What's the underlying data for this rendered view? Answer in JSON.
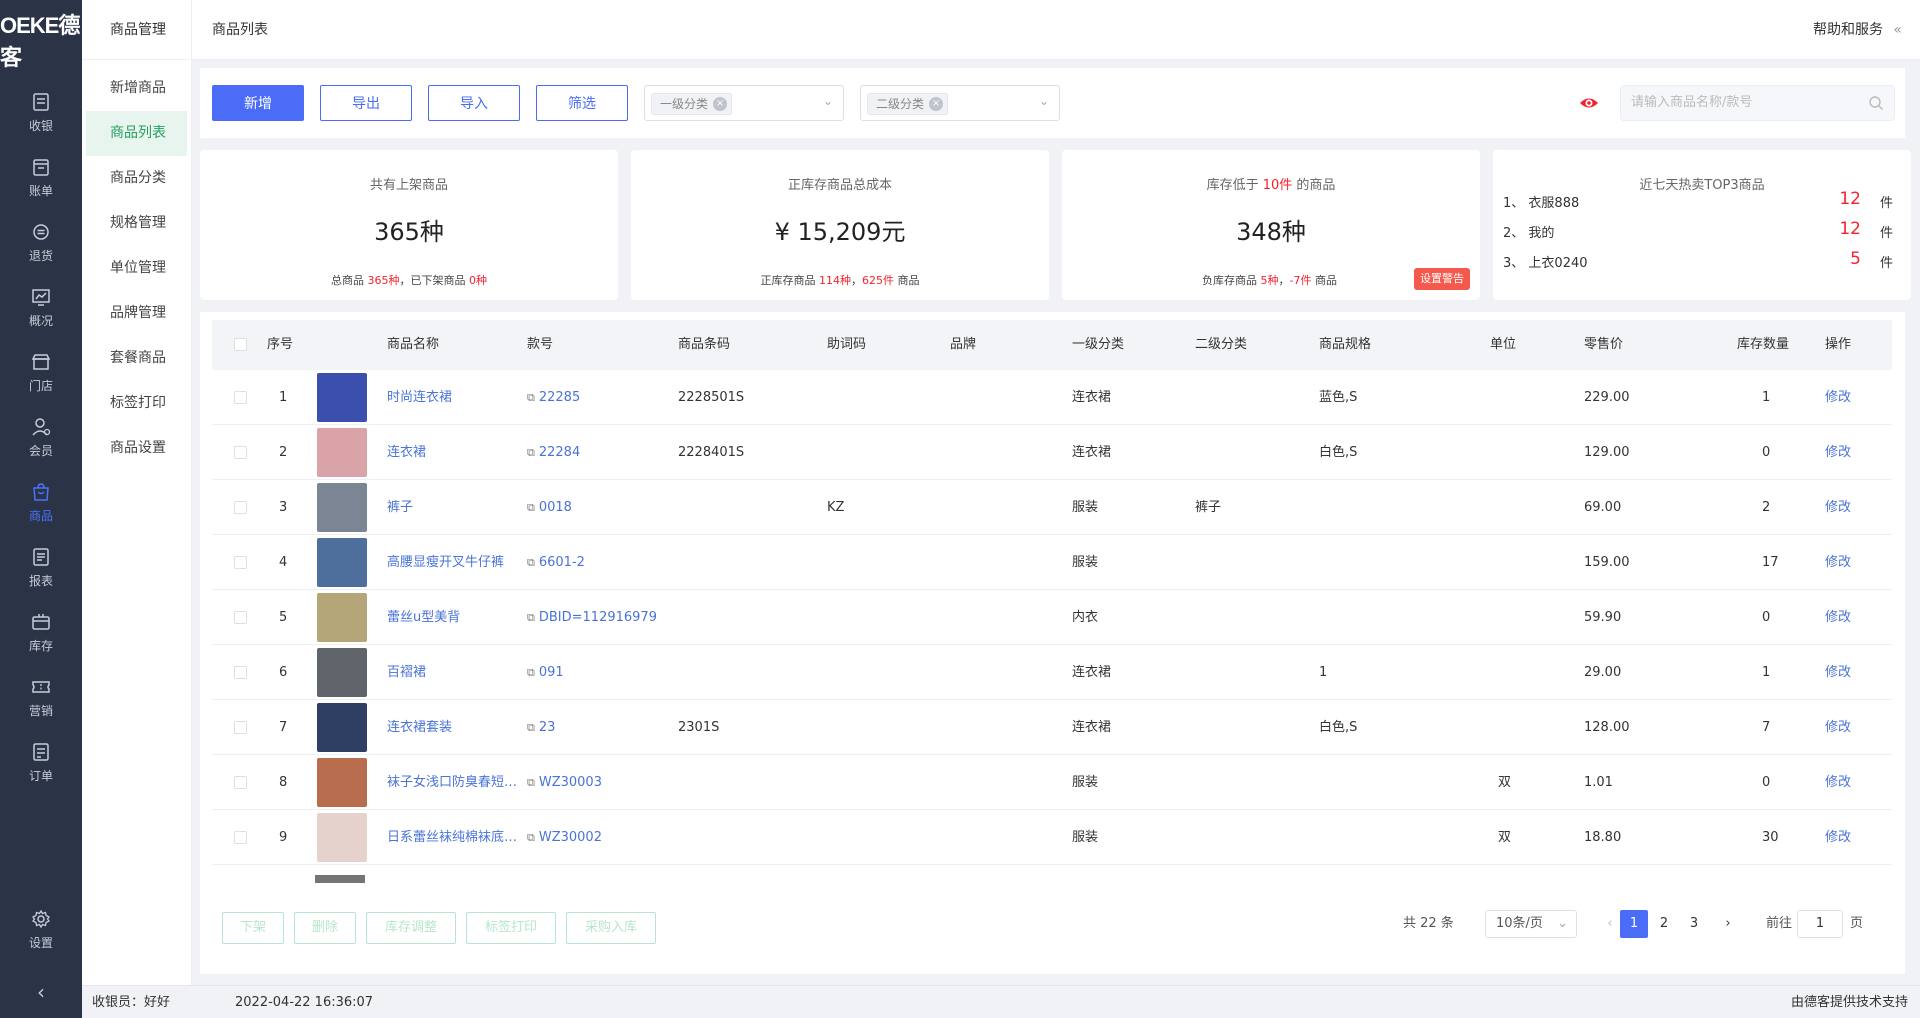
{
  "brand": {
    "logo_text": "OEKE德客"
  },
  "leftnav": [
    {
      "label": "收银",
      "icon": "cashier-icon"
    },
    {
      "label": "账单",
      "icon": "bill-icon"
    },
    {
      "label": "退货",
      "icon": "return-icon"
    },
    {
      "label": "概况",
      "icon": "overview-chart-icon"
    },
    {
      "label": "门店",
      "icon": "store-icon"
    },
    {
      "label": "会员",
      "icon": "member-icon"
    },
    {
      "label": "商品",
      "icon": "goods-bag-icon",
      "active": true
    },
    {
      "label": "报表",
      "icon": "report-icon"
    },
    {
      "label": "库存",
      "icon": "inventory-box-icon"
    },
    {
      "label": "营销",
      "icon": "marketing-ticket-icon"
    },
    {
      "label": "订单",
      "icon": "order-icon"
    }
  ],
  "settings": {
    "label": "设置",
    "icon": "gear-icon"
  },
  "submenu": {
    "title": "商品管理",
    "items": [
      "新增商品",
      "商品列表",
      "商品分类",
      "规格管理",
      "单位管理",
      "品牌管理",
      "套餐商品",
      "标签打印",
      "商品设置"
    ],
    "active_index": 1
  },
  "topbar": {
    "breadcrumb": "商品列表",
    "help": "帮助和服务"
  },
  "toolbar": {
    "add": "新增",
    "export": "导出",
    "import": "导入",
    "filter": "筛选",
    "cat1_tag": "一级分类",
    "cat2_tag": "二级分类",
    "search_placeholder": "请输入商品名称/款号"
  },
  "cards": {
    "c1": {
      "title": "共有上架商品",
      "value": "365种",
      "foot_a": "总商品 ",
      "foot_b": "365种",
      "foot_c": "，已下架商品 ",
      "foot_d": "0种"
    },
    "c2": {
      "title": "正库存商品总成本",
      "value": "¥ 15,209元",
      "foot_a": "正库存商品 ",
      "foot_b": "114种",
      "foot_c": "，",
      "foot_d": "625件",
      "foot_e": " 商品"
    },
    "c3": {
      "title_a": "库存低于 ",
      "title_b": "10件",
      "title_c": " 的商品",
      "value": "348种",
      "foot_a": "负库存商品 ",
      "foot_b": "5种",
      "foot_c": "，",
      "foot_d": "-7件",
      "foot_e": " 商品",
      "warn": "设置警告"
    },
    "c4": {
      "title": "近七天热卖TOP3商品",
      "items": [
        {
          "rank": "1、",
          "name": "衣服888",
          "count": "12",
          "unit": "件"
        },
        {
          "rank": "2、",
          "name": "我的",
          "count": "12",
          "unit": "件"
        },
        {
          "rank": "3、",
          "name": "上衣0240",
          "count": "5",
          "unit": "件"
        }
      ]
    }
  },
  "table": {
    "headers": [
      "序号",
      "商品名称",
      "款号",
      "商品条码",
      "助词码",
      "品牌",
      "一级分类",
      "二级分类",
      "商品规格",
      "单位",
      "零售价",
      "库存数量",
      "操作"
    ],
    "rows": [
      {
        "no": "1",
        "name": "时尚连衣裙",
        "style": "22285",
        "barcode": "2228501S",
        "code": "",
        "brand": "",
        "cat1": "连衣裙",
        "cat2": "",
        "spec": "蓝色,S",
        "unit": "",
        "price": "229.00",
        "stock": "1",
        "op": "修改",
        "thumb": "#3a4fae"
      },
      {
        "no": "2",
        "name": "连衣裙",
        "style": "22284",
        "barcode": "2228401S",
        "code": "",
        "brand": "",
        "cat1": "连衣裙",
        "cat2": "",
        "spec": "白色,S",
        "unit": "",
        "price": "129.00",
        "stock": "0",
        "op": "修改",
        "thumb": "#d9a3a8"
      },
      {
        "no": "3",
        "name": "裤子",
        "style": "0018",
        "barcode": "",
        "code": "KZ",
        "brand": "",
        "cat1": "服装",
        "cat2": "裤子",
        "spec": "",
        "unit": "",
        "price": "69.00",
        "stock": "2",
        "op": "修改",
        "thumb": "#7c8593"
      },
      {
        "no": "4",
        "name": "高腰显瘦开叉牛仔裤",
        "style": "6601-2",
        "barcode": "",
        "code": "",
        "brand": "",
        "cat1": "服装",
        "cat2": "",
        "spec": "",
        "unit": "",
        "price": "159.00",
        "stock": "17",
        "op": "修改",
        "thumb": "#4e6f9c"
      },
      {
        "no": "5",
        "name": "蕾丝u型美背",
        "style": "DBID=112916979",
        "barcode": "",
        "code": "",
        "brand": "",
        "cat1": "内衣",
        "cat2": "",
        "spec": "",
        "unit": "",
        "price": "59.90",
        "stock": "0",
        "op": "修改",
        "thumb": "#b5a67a"
      },
      {
        "no": "6",
        "name": "百褶裙",
        "style": "091",
        "barcode": "",
        "code": "",
        "brand": "",
        "cat1": "连衣裙",
        "cat2": "",
        "spec": "1",
        "unit": "",
        "price": "29.00",
        "stock": "1",
        "op": "修改",
        "thumb": "#60646b"
      },
      {
        "no": "7",
        "name": "连衣裙套装",
        "style": "23",
        "barcode": "2301S",
        "code": "",
        "brand": "",
        "cat1": "连衣裙",
        "cat2": "",
        "spec": "白色,S",
        "unit": "",
        "price": "128.00",
        "stock": "7",
        "op": "修改",
        "thumb": "#2f3f63"
      },
      {
        "no": "8",
        "name": "袜子女浅口防臭春短…",
        "style": "WZ30003",
        "barcode": "",
        "code": "",
        "brand": "",
        "cat1": "服装",
        "cat2": "",
        "spec": "",
        "unit": "双",
        "price": "1.01",
        "stock": "0",
        "op": "修改",
        "thumb": "#b86d4e"
      },
      {
        "no": "9",
        "name": "日系蕾丝袜纯棉袜底…",
        "style": "WZ30002",
        "barcode": "",
        "code": "",
        "brand": "",
        "cat1": "服装",
        "cat2": "",
        "spec": "",
        "unit": "双",
        "price": "18.80",
        "stock": "30",
        "op": "修改",
        "thumb": "#e6d2cc"
      }
    ]
  },
  "batch": [
    "下架",
    "删除",
    "库存调整",
    "标签打印",
    "采购入库"
  ],
  "pagination": {
    "total": "共 22 条",
    "page_size": "10条/页",
    "pages": [
      "1",
      "2",
      "3"
    ],
    "current": "1",
    "goto_prefix": "前往",
    "goto_value": "1",
    "goto_suffix": "页",
    "prev": "‹",
    "next": "›"
  },
  "status": {
    "cashier": "收银员：好好",
    "datetime": "2022-04-22 16:36:07",
    "support": "由德客提供技术支持"
  }
}
